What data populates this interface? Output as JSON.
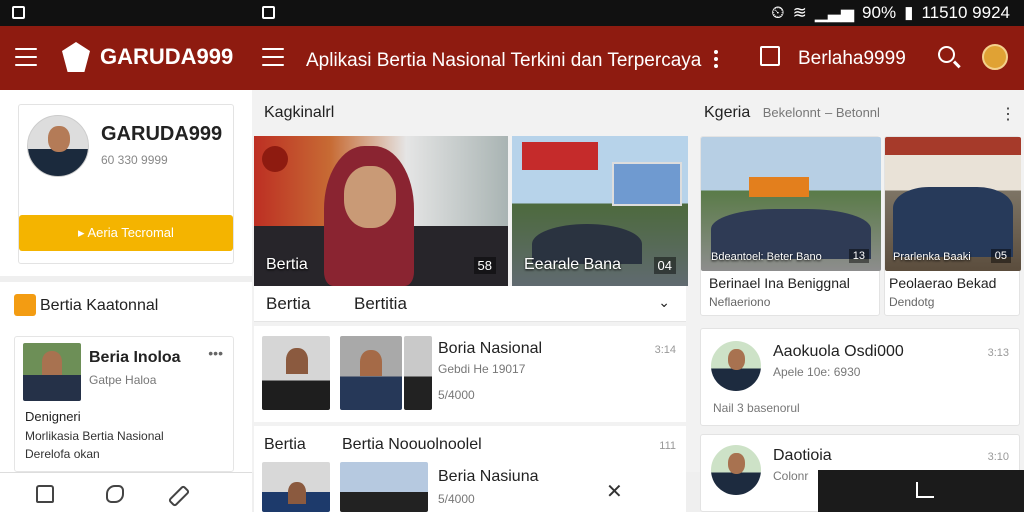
{
  "status_bar": {
    "battery": "90%",
    "time": "11510 9924"
  },
  "app_bar": {
    "brand": "GARUDA999",
    "title": "Aplikasi Bertia Nasional Terkini dan Terpercaya",
    "account": "Berlaha9999"
  },
  "profile": {
    "name": "GARUDA999",
    "id": "60 330 9999",
    "button": "Aeria Tecromal"
  },
  "left_section": {
    "title": "Bertia Kaatonnal"
  },
  "left_card": {
    "title": "Beria Inoloa",
    "subtitle": "Gatpe Haloa",
    "label": "Denigneri",
    "body1": "Morlikasia Bertia Nasional",
    "body2": "Derelofa okan"
  },
  "center": {
    "heading": "Kagkinalrl",
    "hero1": {
      "label": "Bertia",
      "badge": "58"
    },
    "hero2": {
      "label": "Eearale Bana",
      "badge": "04"
    },
    "tabs": [
      "Bertia",
      "Bertitia"
    ],
    "list": [
      {
        "title": "Boria Nasional",
        "subtitle": "Gebdi He 19017",
        "meta": "5/4000",
        "date": "3:14"
      },
      {
        "section": "Bertia",
        "title": "Bertia Noouolnoolel",
        "meta_right": "111"
      },
      {
        "title": "Beria Nasiuna",
        "meta": "5/4000"
      }
    ]
  },
  "right": {
    "heading": "Kgeria",
    "heading_sub": "Bekelonnt",
    "heading_sub2": "Betonnl",
    "tiles": [
      {
        "caption": "Bdeantoel: Beter Bano",
        "badge": "13",
        "title": "Berinael Ina Beniggnal",
        "sub": "Neflaeriono"
      },
      {
        "caption": "Prarlenka Baaki",
        "badge": "05",
        "title": "Peolaerao Bekad",
        "sub": "Dendotg"
      }
    ],
    "cards": [
      {
        "title": "Aaokuola Osdi000",
        "sub": "Apele 10e: 6930",
        "extra": "Nail 3 basenorul",
        "meta": "3:13"
      },
      {
        "title": "Daotioia",
        "sub": "Colonr",
        "meta": "3:10"
      }
    ]
  },
  "colors": {
    "brand": "#8e1b10",
    "accent": "#f4b400"
  }
}
